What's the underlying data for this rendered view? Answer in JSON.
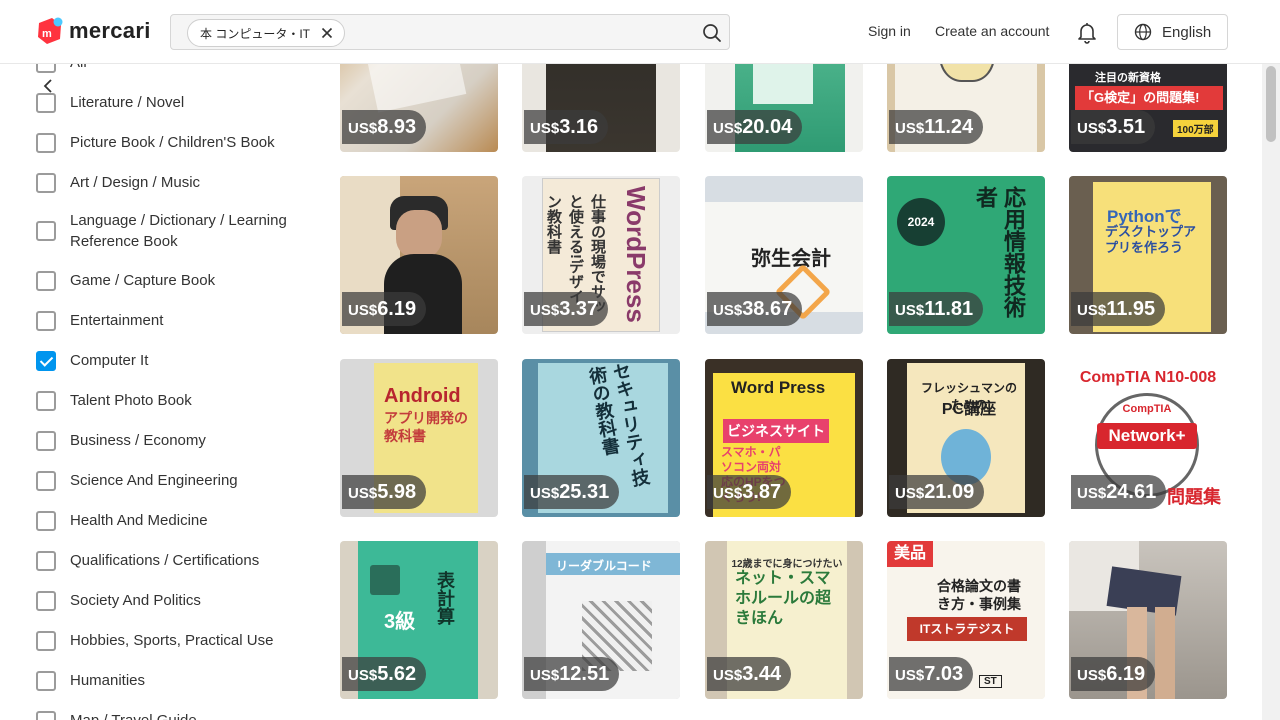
{
  "header": {
    "logo_text": "mercari",
    "search_chip": "本 コンピュータ・IT",
    "sign_in": "Sign in",
    "create_account": "Create an account",
    "language": "English"
  },
  "sidebar": {
    "items": [
      {
        "label": "All",
        "checked": false
      },
      {
        "label": "Literature / Novel",
        "checked": false
      },
      {
        "label": "Picture Book / Children'S Book",
        "checked": false
      },
      {
        "label": "Art / Design / Music",
        "checked": false
      },
      {
        "label": "Language / Dictionary / Learning Reference Book",
        "checked": false
      },
      {
        "label": "Game / Capture Book",
        "checked": false
      },
      {
        "label": "Entertainment",
        "checked": false
      },
      {
        "label": "Computer It",
        "checked": true
      },
      {
        "label": "Talent Photo Book",
        "checked": false
      },
      {
        "label": "Business / Economy",
        "checked": false
      },
      {
        "label": "Science And Engineering",
        "checked": false
      },
      {
        "label": "Health And Medicine",
        "checked": false
      },
      {
        "label": "Qualifications / Certifications",
        "checked": false
      },
      {
        "label": "Society And Politics",
        "checked": false
      },
      {
        "label": "Hobbies, Sports, Practical Use",
        "checked": false
      },
      {
        "label": "Humanities",
        "checked": false
      },
      {
        "label": "Map / Travel Guide",
        "checked": false
      }
    ]
  },
  "currency": "US$",
  "products": [
    {
      "price": "8.93"
    },
    {
      "price": "3.16"
    },
    {
      "price": "20.04"
    },
    {
      "price": "11.24"
    },
    {
      "price": "3.51"
    },
    {
      "price": "6.19"
    },
    {
      "price": "3.37"
    },
    {
      "price": "38.67"
    },
    {
      "price": "11.81"
    },
    {
      "price": "11.95"
    },
    {
      "price": "5.98"
    },
    {
      "price": "25.31"
    },
    {
      "price": "3.87"
    },
    {
      "price": "21.09"
    },
    {
      "price": "24.61"
    },
    {
      "price": "5.62"
    },
    {
      "price": "12.51"
    },
    {
      "price": "3.44"
    },
    {
      "price": "7.03"
    },
    {
      "price": "6.19"
    }
  ],
  "cover_text": {
    "t0_3": "注目の新資格",
    "t0_3b": "「G検定」の問題集!",
    "t0_3c": "100万部",
    "t1_1": "WordPress",
    "t1_1b": "仕事の現場でサッと使える!デザイン教科書",
    "t1_2": "弥生会計",
    "t1_3": "応用情報技術者",
    "t1_3b": "2024",
    "t1_4": "Pythonで",
    "t1_4b": "デスクトップアプリを作ろう",
    "t2_0": "Android",
    "t2_0b": "アプリ開発の教科書",
    "t2_1": "セキュリティ技術の教科書",
    "t2_2": "Word Press",
    "t2_2b": "ビジネスサイト",
    "t2_2c": "スマホ・パソコン両対応のHPをつくろう!",
    "t2_3": "フレッシュマンのための",
    "t2_3b": "PC講座",
    "t2_4": "CompTIA N10-008",
    "t2_4b": "CompTIA",
    "t2_4c": "Network+",
    "t2_4d": "問題集",
    "t3_0": "表計算",
    "t3_0b": "3級",
    "t3_1": "リーダブルコード",
    "t3_2": "12歳までに身につけたい",
    "t3_2b": "ネット・スマホルールの超きほん",
    "t3_3": "美品",
    "t3_3b": "合格論文の書き方・事例集",
    "t3_3c": "ITストラテジスト",
    "t3_3d": "ST"
  },
  "colors": {
    "brand_red": "#ff333f",
    "brand_blue": "#4dc9ff",
    "checkbox_on": "#0095ee"
  }
}
